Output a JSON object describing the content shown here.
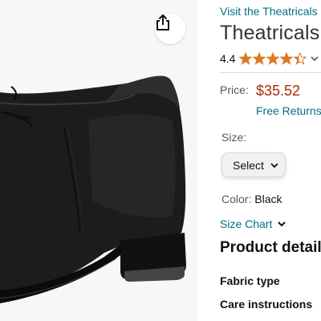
{
  "store_link": "Visit the Theatricals Store",
  "title": "Theatricals",
  "rating": {
    "value": "4.4",
    "stars_filled": 4.4,
    "star_color": "#de7921"
  },
  "price": {
    "label": "Price:",
    "value": "$35.52",
    "free_returns": "Free Returns"
  },
  "size": {
    "label": "Size:",
    "select_value": "Select"
  },
  "color": {
    "label": "Color:",
    "value": "Black"
  },
  "size_chart": "Size Chart",
  "product_details": {
    "title": "Product details",
    "rows": [
      {
        "label": "Fabric type"
      },
      {
        "label": "Care instructions"
      }
    ]
  },
  "icons": {
    "share": "share-icon",
    "chevron": "chevron-down-icon",
    "star": "star-icon"
  },
  "colors": {
    "link": "#007185",
    "price": "#b12704",
    "shoe": "#1e1e1e"
  }
}
